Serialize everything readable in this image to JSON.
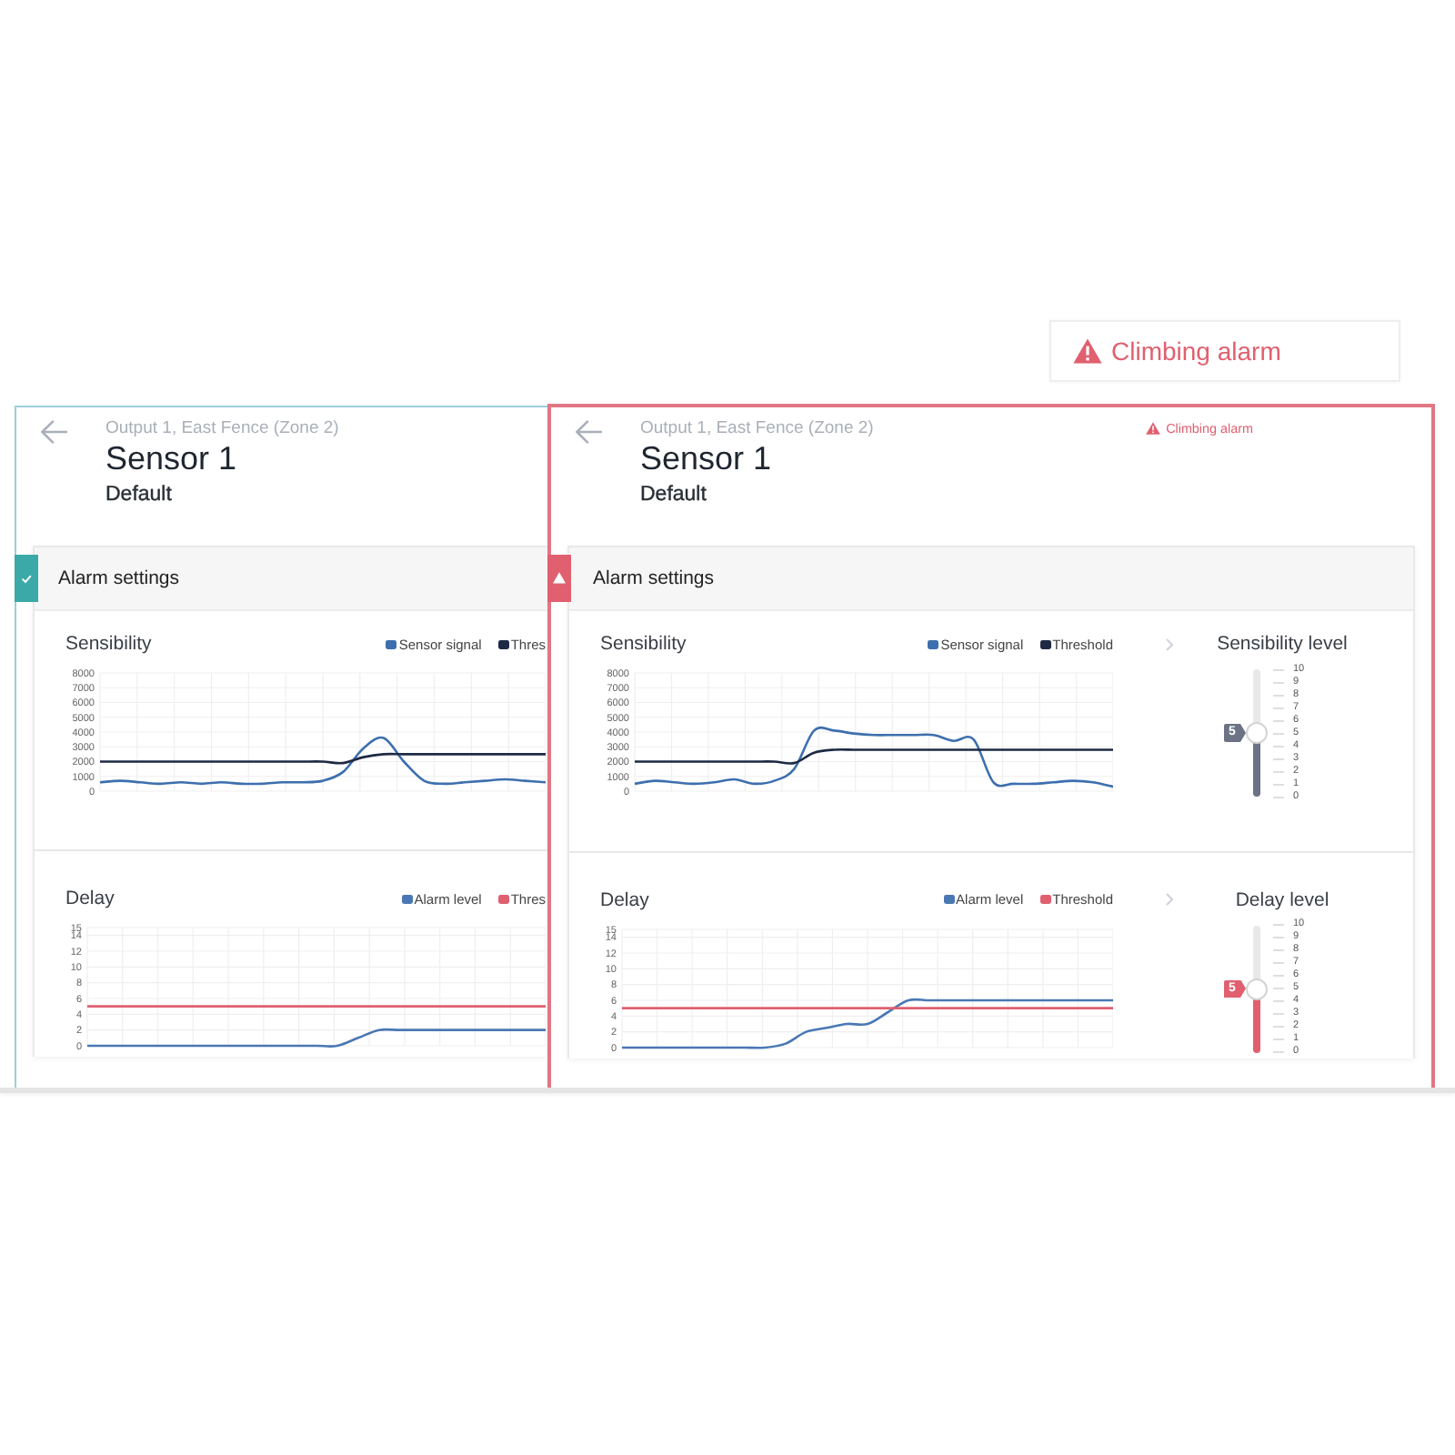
{
  "toast": {
    "text": "Climbing alarm"
  },
  "cards": [
    {
      "alarm": false,
      "breadcrumb": "Output 1, East Fence (Zone 2)",
      "title": "Sensor 1",
      "subtitle": "Default",
      "panel": {
        "title": "Alarm settings",
        "sections": [
          {
            "title": "Sensibility",
            "chart_data": {
              "type": "line",
              "grid": true,
              "legend": true,
              "ylim": [
                0,
                8000
              ],
              "yticks": [
                {
                  "value": 0,
                  "label": "0"
                },
                {
                  "value": 1000,
                  "label": "1000"
                },
                {
                  "value": 2000,
                  "label": "2000"
                },
                {
                  "value": 3000,
                  "label": "3000"
                },
                {
                  "value": 4000,
                  "label": "4000"
                },
                {
                  "value": 5000,
                  "label": "5000"
                },
                {
                  "value": 6000,
                  "label": "6000"
                },
                {
                  "value": 7000,
                  "label": "7000"
                },
                {
                  "value": 8000,
                  "label": "8000"
                }
              ],
              "series": [
                {
                  "name": "Sensor signal",
                  "color": "#3d6fae",
                  "values": [
                    600,
                    700,
                    600,
                    500,
                    600,
                    500,
                    600,
                    500,
                    500,
                    600,
                    600,
                    700,
                    1300,
                    2900,
                    3600,
                    2000,
                    700,
                    500,
                    600,
                    700,
                    800,
                    700,
                    600
                  ]
                },
                {
                  "name": "Thres",
                  "color": "#1e2a44",
                  "values": [
                    2000,
                    2000,
                    2000,
                    2000,
                    2000,
                    2000,
                    2000,
                    2000,
                    2000,
                    2000,
                    2000,
                    2000,
                    1900,
                    2300,
                    2500,
                    2500,
                    2500,
                    2500,
                    2500,
                    2500,
                    2500,
                    2500,
                    2500
                  ]
                }
              ]
            }
          },
          {
            "title": "Delay",
            "chart_data": {
              "type": "line",
              "grid": true,
              "legend": true,
              "ylim": [
                0,
                15
              ],
              "yticks": [
                {
                  "value": 0,
                  "label": "0"
                },
                {
                  "value": 2,
                  "label": "2"
                },
                {
                  "value": 4,
                  "label": "4"
                },
                {
                  "value": 6,
                  "label": "6"
                },
                {
                  "value": 8,
                  "label": "8"
                },
                {
                  "value": 10,
                  "label": "10"
                },
                {
                  "value": 12,
                  "label": "12"
                },
                {
                  "value": 14,
                  "label": "14"
                },
                {
                  "value": 15,
                  "label": "15"
                }
              ],
              "series": [
                {
                  "name": "Alarm level",
                  "color": "#4a78b4",
                  "values": [
                    0,
                    0,
                    0,
                    0,
                    0,
                    0,
                    0,
                    0,
                    0,
                    0,
                    0,
                    0,
                    0,
                    1,
                    2,
                    2,
                    2,
                    2,
                    2,
                    2,
                    2,
                    2,
                    2
                  ]
                },
                {
                  "name": "Thres",
                  "color": "#e0606f",
                  "values": [
                    5,
                    5,
                    5,
                    5,
                    5,
                    5,
                    5,
                    5,
                    5,
                    5,
                    5,
                    5,
                    5,
                    5,
                    5,
                    5,
                    5,
                    5,
                    5,
                    5,
                    5,
                    5,
                    5
                  ]
                }
              ]
            }
          }
        ]
      }
    },
    {
      "alarm": true,
      "breadcrumb": "Output 1, East Fence (Zone 2)",
      "alert": "Climbing alarm",
      "title": "Sensor 1",
      "subtitle": "Default",
      "panel": {
        "title": "Alarm settings",
        "sections": [
          {
            "title": "Sensibility",
            "chart_data": {
              "type": "line",
              "grid": true,
              "legend": true,
              "ylim": [
                0,
                8000
              ],
              "yticks": [
                {
                  "value": 0,
                  "label": "0"
                },
                {
                  "value": 1000,
                  "label": "1000"
                },
                {
                  "value": 2000,
                  "label": "2000"
                },
                {
                  "value": 3000,
                  "label": "3000"
                },
                {
                  "value": 4000,
                  "label": "4000"
                },
                {
                  "value": 5000,
                  "label": "5000"
                },
                {
                  "value": 6000,
                  "label": "6000"
                },
                {
                  "value": 7000,
                  "label": "7000"
                },
                {
                  "value": 8000,
                  "label": "8000"
                }
              ],
              "series": [
                {
                  "name": "Sensor signal",
                  "color": "#3d6fae",
                  "values": [
                    500,
                    700,
                    600,
                    500,
                    600,
                    800,
                    500,
                    700,
                    1500,
                    4100,
                    4100,
                    3900,
                    3800,
                    3800,
                    3800,
                    3800,
                    3400,
                    3500,
                    600,
                    500,
                    500,
                    600,
                    700,
                    600,
                    300
                  ]
                },
                {
                  "name": "Threshold",
                  "color": "#1e2a44",
                  "values": [
                    2000,
                    2000,
                    2000,
                    2000,
                    2000,
                    2000,
                    2000,
                    2000,
                    1900,
                    2600,
                    2800,
                    2800,
                    2800,
                    2800,
                    2800,
                    2800,
                    2800,
                    2800,
                    2800,
                    2800,
                    2800,
                    2800,
                    2800,
                    2800,
                    2800
                  ]
                }
              ]
            },
            "level_control": {
              "label": "Sensibility level",
              "value": "5",
              "level": 0.5,
              "color": "#6b7384",
              "ticks": [
                "10",
                "9",
                "8",
                "7",
                "6",
                "5",
                "4",
                "3",
                "2",
                "1",
                "0"
              ]
            }
          },
          {
            "title": "Delay",
            "chart_data": {
              "type": "line",
              "grid": true,
              "legend": true,
              "ylim": [
                0,
                15
              ],
              "yticks": [
                {
                  "value": 0,
                  "label": "0"
                },
                {
                  "value": 2,
                  "label": "2"
                },
                {
                  "value": 4,
                  "label": "4"
                },
                {
                  "value": 6,
                  "label": "6"
                },
                {
                  "value": 8,
                  "label": "8"
                },
                {
                  "value": 10,
                  "label": "10"
                },
                {
                  "value": 12,
                  "label": "12"
                },
                {
                  "value": 14,
                  "label": "14"
                },
                {
                  "value": 15,
                  "label": "15"
                }
              ],
              "series": [
                {
                  "name": "Alarm level",
                  "color": "#4a78b4",
                  "values": [
                    0,
                    0,
                    0,
                    0,
                    0,
                    0,
                    0,
                    0,
                    0.5,
                    2,
                    2.5,
                    3,
                    3,
                    4.5,
                    6,
                    6,
                    6,
                    6,
                    6,
                    6,
                    6,
                    6,
                    6,
                    6,
                    6
                  ]
                },
                {
                  "name": "Threshold",
                  "color": "#e0606f",
                  "values": [
                    5,
                    5,
                    5,
                    5,
                    5,
                    5,
                    5,
                    5,
                    5,
                    5,
                    5,
                    5,
                    5,
                    5,
                    5,
                    5,
                    5,
                    5,
                    5,
                    5,
                    5,
                    5,
                    5,
                    5,
                    5
                  ]
                }
              ]
            },
            "level_control": {
              "label": "Delay level",
              "value": "5",
              "level": 0.5,
              "color": "#e0606f",
              "ticks": [
                "10",
                "9",
                "8",
                "7",
                "6",
                "5",
                "4",
                "3",
                "2",
                "1",
                "0"
              ]
            }
          }
        ]
      }
    }
  ]
}
